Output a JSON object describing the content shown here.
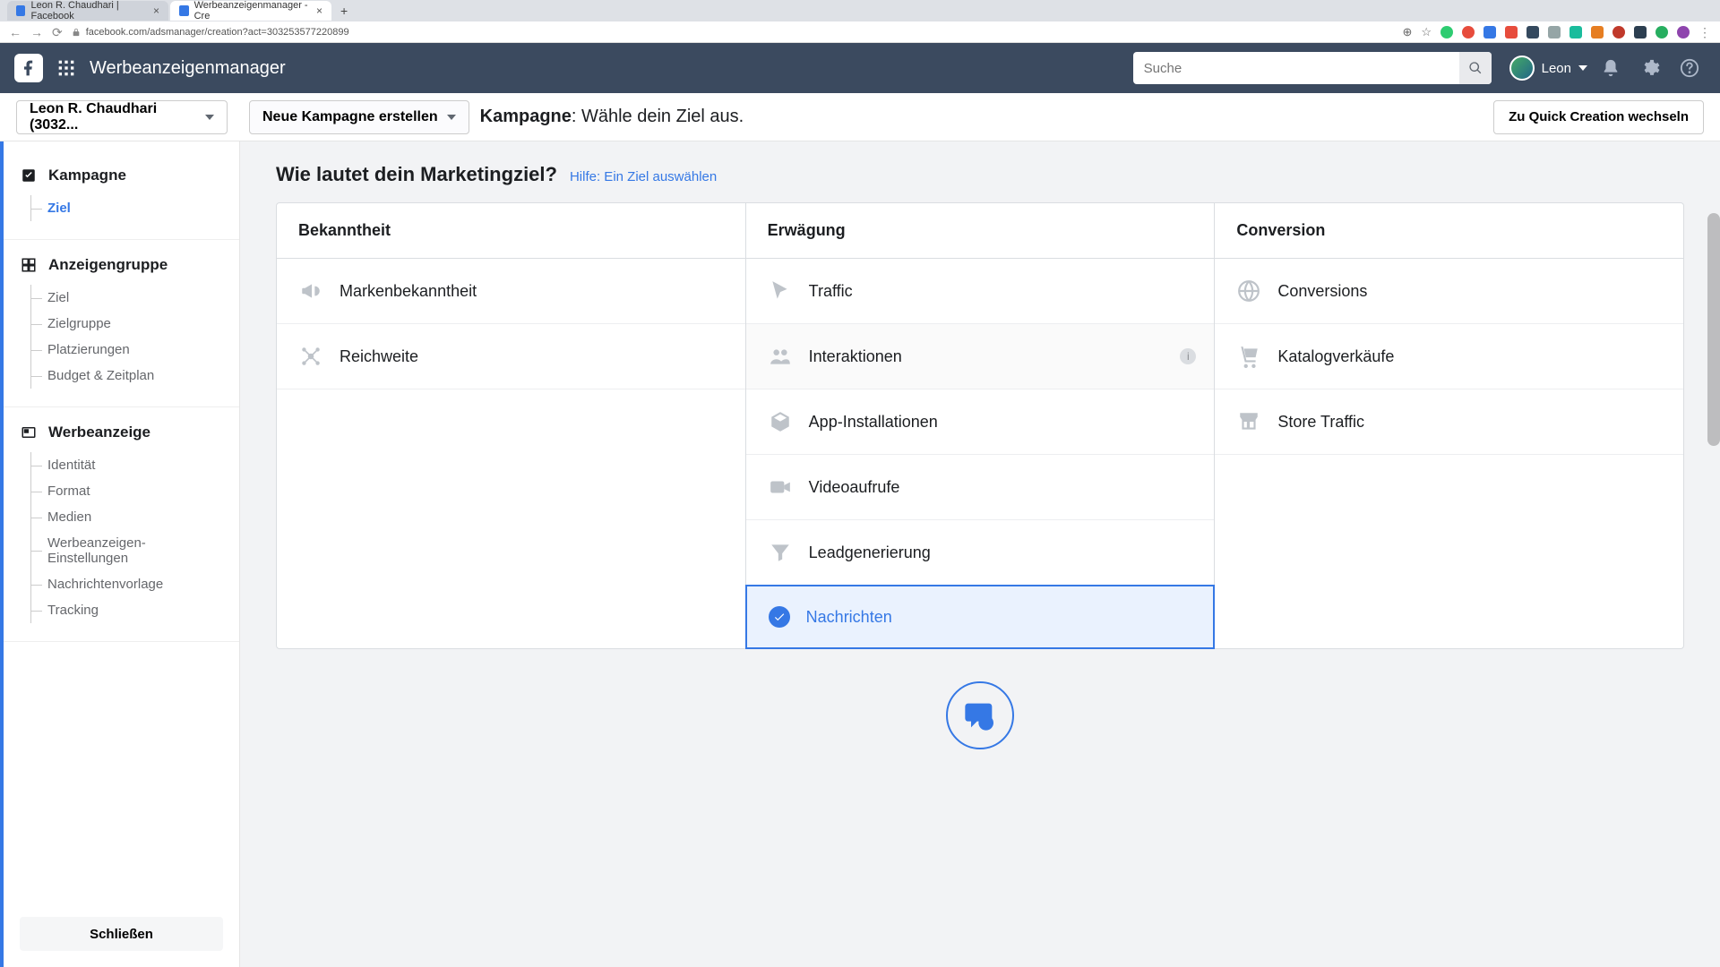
{
  "browser": {
    "tabs": [
      {
        "title": "Leon R. Chaudhari | Facebook",
        "favicon": "#3578e5"
      },
      {
        "title": "Werbeanzeigenmanager - Cre",
        "favicon": "#3578e5"
      }
    ],
    "url": "facebook.com/adsmanager/creation?act=303253577220899"
  },
  "header": {
    "title": "Werbeanzeigenmanager",
    "search_placeholder": "Suche",
    "user_name": "Leon"
  },
  "toolbar": {
    "account": "Leon R. Chaudhari (3032...",
    "campaign_dd": "Neue Kampagne erstellen",
    "title_bold": "Kampagne",
    "title_rest": ": Wähle dein Ziel aus.",
    "quick_btn": "Zu Quick Creation wechseln"
  },
  "sidebar": {
    "sections": [
      {
        "title": "Kampagne",
        "items": [
          "Ziel"
        ],
        "active_index": 0
      },
      {
        "title": "Anzeigengruppe",
        "items": [
          "Ziel",
          "Zielgruppe",
          "Platzierungen",
          "Budget & Zeitplan"
        ],
        "active_index": -1
      },
      {
        "title": "Werbeanzeige",
        "items": [
          "Identität",
          "Format",
          "Medien",
          "Werbeanzeigen-Einstellungen",
          "Nachrichtenvorlage",
          "Tracking"
        ],
        "active_index": -1
      }
    ],
    "close": "Schließen"
  },
  "main": {
    "heading": "Wie lautet dein Marketingziel?",
    "help": "Hilfe: Ein Ziel auswählen",
    "columns": [
      {
        "title": "Bekanntheit",
        "goals": [
          {
            "label": "Markenbekanntheit",
            "icon": "megaphone"
          },
          {
            "label": "Reichweite",
            "icon": "spread"
          }
        ]
      },
      {
        "title": "Erwägung",
        "goals": [
          {
            "label": "Traffic",
            "icon": "cursor"
          },
          {
            "label": "Interaktionen",
            "icon": "people",
            "hover": true
          },
          {
            "label": "App-Installationen",
            "icon": "box"
          },
          {
            "label": "Videoaufrufe",
            "icon": "video"
          },
          {
            "label": "Leadgenerierung",
            "icon": "funnel"
          },
          {
            "label": "Nachrichten",
            "icon": "check",
            "selected": true
          }
        ]
      },
      {
        "title": "Conversion",
        "goals": [
          {
            "label": "Conversions",
            "icon": "globe"
          },
          {
            "label": "Katalogverkäufe",
            "icon": "cart"
          },
          {
            "label": "Store Traffic",
            "icon": "store"
          }
        ]
      }
    ]
  }
}
